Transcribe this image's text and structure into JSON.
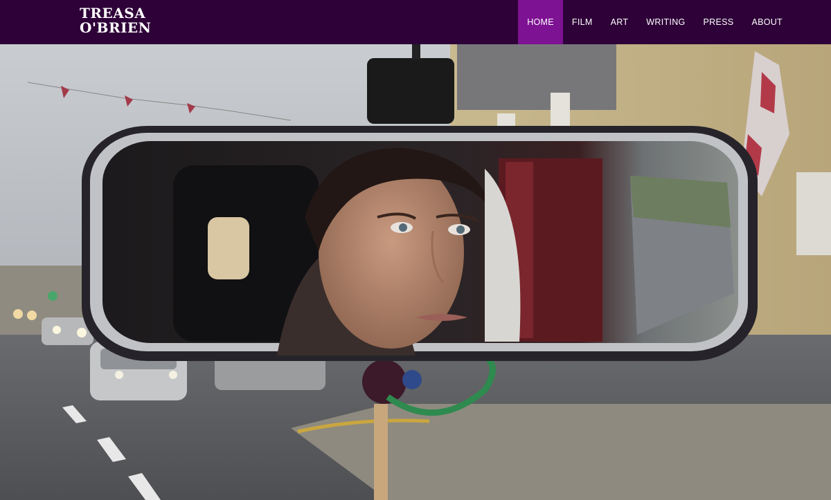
{
  "site": {
    "logo_line1": "TREASA",
    "logo_line2": "O'BRIEN"
  },
  "nav": {
    "items": [
      {
        "label": "HOME",
        "active": true
      },
      {
        "label": "FILM",
        "active": false
      },
      {
        "label": "ART",
        "active": false
      },
      {
        "label": "WRITING",
        "active": false
      },
      {
        "label": "PRESS",
        "active": false
      },
      {
        "label": "ABOUT",
        "active": false
      }
    ]
  },
  "colors": {
    "nav_background": "#2e0138",
    "nav_active": "#7d1292",
    "nav_text": "#ffffff"
  }
}
